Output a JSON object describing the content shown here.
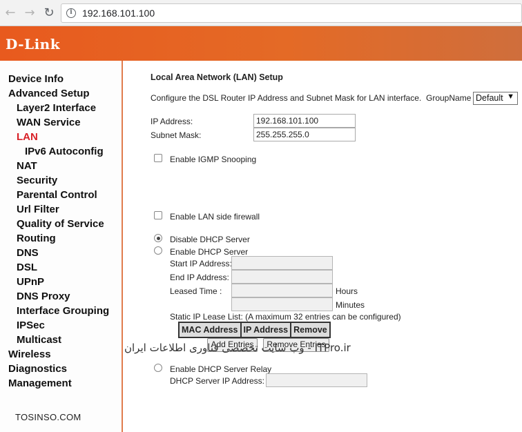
{
  "browser": {
    "url": "192.168.101.100"
  },
  "header": {
    "logo": "D-Link"
  },
  "sidebar": {
    "items": [
      {
        "label": "Device Info",
        "level": 0
      },
      {
        "label": "Advanced Setup",
        "level": 0
      },
      {
        "label": "Layer2 Interface",
        "level": 1
      },
      {
        "label": "WAN Service",
        "level": 1
      },
      {
        "label": "LAN",
        "level": 1,
        "active": true
      },
      {
        "label": "IPv6 Autoconfig",
        "level": 2
      },
      {
        "label": "NAT",
        "level": 1
      },
      {
        "label": "Security",
        "level": 1
      },
      {
        "label": "Parental Control",
        "level": 1
      },
      {
        "label": "Url Filter",
        "level": 1
      },
      {
        "label": "Quality of Service",
        "level": 1
      },
      {
        "label": "Routing",
        "level": 1
      },
      {
        "label": "DNS",
        "level": 1
      },
      {
        "label": "DSL",
        "level": 1
      },
      {
        "label": "UPnP",
        "level": 1
      },
      {
        "label": "DNS Proxy",
        "level": 1
      },
      {
        "label": "Interface Grouping",
        "level": 1
      },
      {
        "label": "IPSec",
        "level": 1
      },
      {
        "label": "Multicast",
        "level": 1
      },
      {
        "label": "Wireless",
        "level": 0
      },
      {
        "label": "Diagnostics",
        "level": 0
      },
      {
        "label": "Management",
        "level": 0
      }
    ],
    "watermark": "TOSINSO.COM"
  },
  "main": {
    "title": "Local Area Network (LAN) Setup",
    "description": "Configure the DSL Router IP Address and Subnet Mask for LAN interface.",
    "group_label": "GroupName",
    "group_value": "Default",
    "ip_label": "IP Address:",
    "ip_value": "192.168.101.100",
    "mask_label": "Subnet Mask:",
    "mask_value": "255.255.255.0",
    "igmp_label": "Enable IGMP Snooping",
    "firewall_label": "Enable LAN side firewall",
    "dhcp": {
      "disable_label": "Disable DHCP Server",
      "enable_label": "Enable DHCP Server",
      "start_label": "Start IP Address:",
      "end_label": "End IP Address:",
      "lease_label": "Leased Time :",
      "hours_label": "Hours",
      "minutes_label": "Minutes",
      "static_label": "Static IP Lease List: (A maximum 32 entries can be configured)",
      "columns": [
        "MAC Address",
        "IP Address",
        "Remove"
      ],
      "add_button": "Add Entries",
      "remove_button": "Remove Entries",
      "relay_label": "Enable DHCP Server Relay",
      "relay_ip_label": "DHCP Server IP Address:"
    }
  },
  "watermark_right": "وب سایت تخصصی فناوری اطلاعات ایران - ITPro.ir"
}
